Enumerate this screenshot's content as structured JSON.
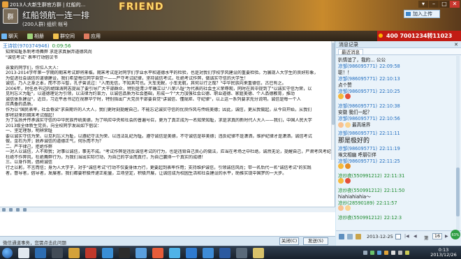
{
  "window": {
    "title": "2013人大新生群官方群 | 红船的...",
    "group_name": "红船领航一连一排",
    "group_sub": "(200人群) 组织 帐号",
    "banner": "FRIEND",
    "upload_label": "加入上传"
  },
  "toolbar": {
    "items": [
      "聊天",
      "相册",
      "群空间",
      "应用"
    ],
    "ad_text": "400 7001234转11023"
  },
  "message": {
    "sender": "王诗钦(970374946)",
    "time": "0:09:56",
    "lines": [
      "知荣知耻系制考场舞弊 求是求真摒弃道德风尚",
      "\"诚信考试\" 表率行动倡议书",
      "",
      "亲爱的同学们，你位人大人：",
      "2013-2014学年第一学期的期末考试即将来临。期末考试是对同学们学业水平和道德水平的检验，也是对我们学校学风建设的重要检验。为展现人大学生的良好形象，",
      "为促进社会诚信的道德建设，我们希望每位同学自觉ー——严守考试纪律，坚持诚信考试，杜绝考试作弊，做诚实守信的大学生！",
      "诚信，乃人之身之本，而不亦斗智，孔子曾说过：\"人而无信，不知其可也。大车无輗，小车无軏，其何以行之哉？\"中华民族向来重德信，古已有之。",
      "2006年，时任总书记的胡锦涛同志提出了要引导广大干部群众，特别是青少年确立以\"八荣八耻\"为代表的社会主义荣辱观，同时在其中提到了\"以诚实守信为荣，以",
      "见利忘义为耻\"，以道德理论为引领，以法律为约束力，以诚信品质为社会基础，形成一个\"大力加强社会公德、职业道德、家庭美德、个人品德教育，推动",
      "诚信体系建设\"，近日，习近平总书记在视察华宁时，特别指出广大党员干部要自觉\"讲诚信、懂规矩、守纪律\"，以上这一系列要求充分说明，诚信是每一个人",
      "应具备的品质。",
      "作为以\"国民表率，社会脊梁\"求自期许的人大人，我们更时刻提醒自己，不能忘记诚实守信的优良作风与传统美德；因此，诚信，更从我做起，从今日开始，从我们",
      "即将迎来的期末考试做起！",
      "为了弘扬并传承诚实守信的中华民族传统美德，为了响应中央和社会的普遍号召，更为了真正成为一名知荣知耻，求是求真的新时代人大人——我们，中国人民大学",
      "2013级全体新生党员，向全校同学发出如下倡议：",
      "一、坚定理想，明辨荣耻",
      "要以诚实守信为荣、以见利忘义为耻，以遵纪守法为荣、以违法乱纪为耻。遵守诚信是美德，不守诚信是非美德；违反纪律不是潇洒，维护纪律才是潇洒，诚信考试",
      "做，金石为开；脱养诚信的道德正气，何乐而不为？",
      "二、严于律己，拒绝作弊",
      "一对人以诚信，人不欺我；对事以诚信，事无不成。\"考试作弊是违反诚信考试的行为，也是违背自己良心的做法，应当在考场之中杜绝。诚然无论，提醒自己，严肃考风考纪，",
      "杜绝不作弊风，杜绝舞弊行为，为我们当出实际行动，为自己的学业而真行，为自己赢得一个真实的成绩！",
      "三、以身作则，倡树诚信",
      "行之以躬，不言而信；身为人大学子，对于\"诚信考试\"行动不仅要身体力行，更要起到表率作用；支持维护诚信，引领诚信风尚；带一名后代一名\"诚信考试\"的实践",
      "者，督导者，倡导者，发展者。我们都要积极传递正能量，立场坚定，积极开展，让诚信成为校园生活和社会建设的水平，助推实现中国梦的一大步。"
    ]
  },
  "input_bar": {
    "notice": "微信通道事务，您需点击此问题",
    "close_label": "关闭(C)",
    "send_label": "发送(S)"
  },
  "history": {
    "header": "消息记录",
    "tab_label": "最近消息",
    "entries": [
      {
        "kind": "text",
        "text": "扒情谊了，我的… 公公"
      },
      {
        "kind": "name",
        "name": "凉邹(986095771)",
        "time": "22:09:58"
      },
      {
        "kind": "text",
        "text": "聪！！"
      },
      {
        "kind": "name",
        "name": "凉邹(986095771)",
        "time": "22:10:13"
      },
      {
        "kind": "text",
        "text": "点个赞"
      },
      {
        "kind": "name",
        "name": "凉邹(986095771)",
        "time": "22:10:25"
      },
      {
        "kind": "emoji",
        "text": ""
      },
      {
        "kind": "name",
        "name": "凉邹(986095771)",
        "time": "22:10:38"
      },
      {
        "kind": "text",
        "text": "安徽  我们一起？"
      },
      {
        "kind": "name",
        "name": "凉邹(986095771)",
        "time": "22:10:56"
      },
      {
        "kind": "emoji",
        "text": "最高境界"
      },
      {
        "kind": "name",
        "name": "凉邹(986095771)",
        "time": "22:11:11"
      },
      {
        "kind": "big",
        "text": "那是极好的"
      },
      {
        "kind": "name",
        "name": "凉邹(986095771)",
        "time": "22:11:19"
      },
      {
        "kind": "text",
        "text": "埃文相幽  呼朋引伴"
      },
      {
        "kind": "name",
        "name": "凉邹(986095771)",
        "time": "22:11:25"
      },
      {
        "kind": "emoji",
        "text": ""
      },
      {
        "kind": "name",
        "name": "凉炒夜(550991212)",
        "time": "22:11:31",
        "green": true
      },
      {
        "kind": "emoji",
        "text": ""
      },
      {
        "kind": "name",
        "name": "凉炒夜(550991212)",
        "time": "22:11:50",
        "green": true
      },
      {
        "kind": "text",
        "text": "hiahiahiahia～"
      },
      {
        "kind": "name",
        "name": "凉炒(28590189)",
        "time": "22:11:57",
        "green": true
      },
      {
        "kind": "emoji",
        "text": ""
      },
      {
        "kind": "name",
        "name": "凉炒夜(550991212)",
        "time": "22:12:3",
        "green": true
      }
    ],
    "date": "2013-12-25",
    "page_label": "第",
    "page_value": "16"
  },
  "network": {
    "up": "0.04K/S",
    "down": "1.3K/S",
    "pct": "63%"
  },
  "taskbar": {
    "time": "0:13",
    "date": "2013/12/26"
  },
  "colors": {
    "accent": "#1f6cbf",
    "ad_red": "#c21c14",
    "green_name": "#1a8a2c"
  }
}
